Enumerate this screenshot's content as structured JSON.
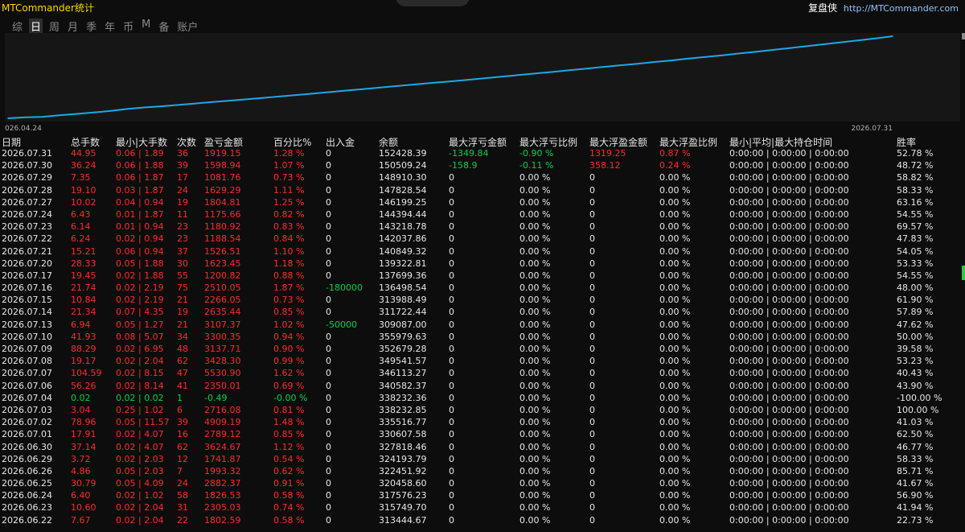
{
  "window": {
    "title": "MTCommander统计",
    "brand_name": "复盘侠",
    "brand_url": "http://MTCommander.com"
  },
  "tabs": [
    {
      "label": "综",
      "active": false
    },
    {
      "label": "日",
      "active": true
    },
    {
      "label": "周",
      "active": false
    },
    {
      "label": "月",
      "active": false
    },
    {
      "label": "季",
      "active": false
    },
    {
      "label": "年",
      "active": false
    },
    {
      "label": "币",
      "active": false
    },
    {
      "label": "M",
      "active": false
    },
    {
      "label": "备",
      "active": false
    },
    {
      "label": "账户",
      "active": false
    }
  ],
  "chart_data": {
    "type": "line",
    "x_start_label": "026.04.24",
    "x_end_label": "2026.07.31",
    "line_color": "#1ea8e6",
    "series": [
      {
        "values": [
          0,
          1.2,
          1.8,
          3.6,
          5.3,
          7.1,
          8.9,
          11.4,
          13.2,
          14.6,
          16.3,
          18.0,
          19.8,
          21.5,
          23.1,
          24.9,
          26.7,
          28.4,
          30.3,
          32.1,
          34.0,
          35.8,
          37.7,
          39.6,
          41.5,
          43.2,
          45.0,
          46.9,
          48.8,
          50.7,
          52.6,
          54.6,
          56.5,
          58.5,
          60.6,
          62.6,
          64.6,
          66.5,
          68.6,
          70.5,
          72.7,
          74.8,
          76.8,
          79.0,
          81.2,
          83.4,
          85.7,
          88.0,
          90.3,
          92.6,
          95.0,
          97.4,
          100
        ]
      }
    ]
  },
  "table": {
    "headers": [
      "日期",
      "总手数",
      "最小|大手数",
      "次数",
      "盈亏金额",
      "百分比%",
      "出入金",
      "余额",
      "最大浮亏金额",
      "最大浮亏比例",
      "最大浮盈金额",
      "最大浮盈比例",
      "最小|平均|最大持仓时间",
      "胜率"
    ],
    "rows": [
      {
        "date": "2026.07.31",
        "lots": "44.95",
        "minmax": "0.06 | 1.89",
        "count": "36",
        "pnl": "1919.15",
        "pct": "1.28 %",
        "flow": "0",
        "bal": "152428.39",
        "mfl": "-1349.84",
        "mflp": "-0.90 %",
        "mfp": "1319.25",
        "mfpp": "0.87 %",
        "time": "0:00:00 | 0:00:00 | 0:00:00",
        "win": "52.78 %",
        "pnl_color": "red",
        "flow_color": "white",
        "mfl_color": "green",
        "mfp_color": "red"
      },
      {
        "date": "2026.07.30",
        "lots": "36.24",
        "minmax": "0.06 | 1.88",
        "count": "39",
        "pnl": "1598.94",
        "pct": "1.07 %",
        "flow": "0",
        "bal": "150509.24",
        "mfl": "-158.9",
        "mflp": "-0.11 %",
        "mfp": "358.12",
        "mfpp": "0.24 %",
        "time": "0:00:00 | 0:00:00 | 0:00:00",
        "win": "48.72 %",
        "pnl_color": "red",
        "flow_color": "white",
        "mfl_color": "green",
        "mfp_color": "red"
      },
      {
        "date": "2026.07.29",
        "lots": "7.35",
        "minmax": "0.06 | 1.87",
        "count": "17",
        "pnl": "1081.76",
        "pct": "0.73 %",
        "flow": "0",
        "bal": "148910.30",
        "mfl": "0",
        "mflp": "0.00 %",
        "mfp": "0",
        "mfpp": "0.00 %",
        "time": "0:00:00 | 0:00:00 | 0:00:00",
        "win": "58.82 %",
        "pnl_color": "red",
        "flow_color": "white",
        "mfl_color": "white",
        "mfp_color": "white"
      },
      {
        "date": "2026.07.28",
        "lots": "19.10",
        "minmax": "0.03 | 1.87",
        "count": "24",
        "pnl": "1629.29",
        "pct": "1.11 %",
        "flow": "0",
        "bal": "147828.54",
        "mfl": "0",
        "mflp": "0.00 %",
        "mfp": "0",
        "mfpp": "0.00 %",
        "time": "0:00:00 | 0:00:00 | 0:00:00",
        "win": "58.33 %",
        "pnl_color": "red",
        "flow_color": "white",
        "mfl_color": "white",
        "mfp_color": "white"
      },
      {
        "date": "2026.07.27",
        "lots": "10.02",
        "minmax": "0.04 | 0.94",
        "count": "19",
        "pnl": "1804.81",
        "pct": "1.25 %",
        "flow": "0",
        "bal": "146199.25",
        "mfl": "0",
        "mflp": "0.00 %",
        "mfp": "0",
        "mfpp": "0.00 %",
        "time": "0:00:00 | 0:00:00 | 0:00:00",
        "win": "63.16 %",
        "pnl_color": "red",
        "flow_color": "white",
        "mfl_color": "white",
        "mfp_color": "white"
      },
      {
        "date": "2026.07.24",
        "lots": "6.43",
        "minmax": "0.01 | 1.87",
        "count": "11",
        "pnl": "1175.66",
        "pct": "0.82 %",
        "flow": "0",
        "bal": "144394.44",
        "mfl": "0",
        "mflp": "0.00 %",
        "mfp": "0",
        "mfpp": "0.00 %",
        "time": "0:00:00 | 0:00:00 | 0:00:00",
        "win": "54.55 %",
        "pnl_color": "red",
        "flow_color": "white",
        "mfl_color": "white",
        "mfp_color": "white"
      },
      {
        "date": "2026.07.23",
        "lots": "6.14",
        "minmax": "0.01 | 0.94",
        "count": "23",
        "pnl": "1180.92",
        "pct": "0.83 %",
        "flow": "0",
        "bal": "143218.78",
        "mfl": "0",
        "mflp": "0.00 %",
        "mfp": "0",
        "mfpp": "0.00 %",
        "time": "0:00:00 | 0:00:00 | 0:00:00",
        "win": "69.57 %",
        "pnl_color": "red",
        "flow_color": "white",
        "mfl_color": "white",
        "mfp_color": "white"
      },
      {
        "date": "2026.07.22",
        "lots": "6.24",
        "minmax": "0.02 | 0.94",
        "count": "23",
        "pnl": "1188.54",
        "pct": "0.84 %",
        "flow": "0",
        "bal": "142037.86",
        "mfl": "0",
        "mflp": "0.00 %",
        "mfp": "0",
        "mfpp": "0.00 %",
        "time": "0:00:00 | 0:00:00 | 0:00:00",
        "win": "47.83 %",
        "pnl_color": "red",
        "flow_color": "white",
        "mfl_color": "white",
        "mfp_color": "white"
      },
      {
        "date": "2026.07.21",
        "lots": "15.21",
        "minmax": "0.06 | 0.94",
        "count": "37",
        "pnl": "1526.51",
        "pct": "1.10 %",
        "flow": "0",
        "bal": "140849.32",
        "mfl": "0",
        "mflp": "0.00 %",
        "mfp": "0",
        "mfpp": "0.00 %",
        "time": "0:00:00 | 0:00:00 | 0:00:00",
        "win": "54.05 %",
        "pnl_color": "red",
        "flow_color": "white",
        "mfl_color": "white",
        "mfp_color": "white"
      },
      {
        "date": "2026.07.20",
        "lots": "28.33",
        "minmax": "0.05 | 1.88",
        "count": "30",
        "pnl": "1623.45",
        "pct": "1.18 %",
        "flow": "0",
        "bal": "139322.81",
        "mfl": "0",
        "mflp": "0.00 %",
        "mfp": "0",
        "mfpp": "0.00 %",
        "time": "0:00:00 | 0:00:00 | 0:00:00",
        "win": "53.33 %",
        "pnl_color": "red",
        "flow_color": "white",
        "mfl_color": "white",
        "mfp_color": "white"
      },
      {
        "date": "2026.07.17",
        "lots": "19.45",
        "minmax": "0.02 | 1.88",
        "count": "55",
        "pnl": "1200.82",
        "pct": "0.88 %",
        "flow": "0",
        "bal": "137699.36",
        "mfl": "0",
        "mflp": "0.00 %",
        "mfp": "0",
        "mfpp": "0.00 %",
        "time": "0:00:00 | 0:00:00 | 0:00:00",
        "win": "54.55 %",
        "pnl_color": "red",
        "flow_color": "white",
        "mfl_color": "white",
        "mfp_color": "white"
      },
      {
        "date": "2026.07.16",
        "lots": "21.74",
        "minmax": "0.02 | 2.19",
        "count": "75",
        "pnl": "2510.05",
        "pct": "1.87 %",
        "flow": "-180000",
        "bal": "136498.54",
        "mfl": "0",
        "mflp": "0.00 %",
        "mfp": "0",
        "mfpp": "0.00 %",
        "time": "0:00:00 | 0:00:00 | 0:00:00",
        "win": "48.00 %",
        "pnl_color": "red",
        "flow_color": "green",
        "mfl_color": "white",
        "mfp_color": "white"
      },
      {
        "date": "2026.07.15",
        "lots": "10.84",
        "minmax": "0.02 | 2.19",
        "count": "21",
        "pnl": "2266.05",
        "pct": "0.73 %",
        "flow": "0",
        "bal": "313988.49",
        "mfl": "0",
        "mflp": "0.00 %",
        "mfp": "0",
        "mfpp": "0.00 %",
        "time": "0:00:00 | 0:00:00 | 0:00:00",
        "win": "61.90 %",
        "pnl_color": "red",
        "flow_color": "white",
        "mfl_color": "white",
        "mfp_color": "white"
      },
      {
        "date": "2026.07.14",
        "lots": "21.34",
        "minmax": "0.07 | 4.35",
        "count": "19",
        "pnl": "2635.44",
        "pct": "0.85 %",
        "flow": "0",
        "bal": "311722.44",
        "mfl": "0",
        "mflp": "0.00 %",
        "mfp": "0",
        "mfpp": "0.00 %",
        "time": "0:00:00 | 0:00:00 | 0:00:00",
        "win": "57.89 %",
        "pnl_color": "red",
        "flow_color": "white",
        "mfl_color": "white",
        "mfp_color": "white"
      },
      {
        "date": "2026.07.13",
        "lots": "6.94",
        "minmax": "0.05 | 1.27",
        "count": "21",
        "pnl": "3107.37",
        "pct": "1.02 %",
        "flow": "-50000",
        "bal": "309087.00",
        "mfl": "0",
        "mflp": "0.00 %",
        "mfp": "0",
        "mfpp": "0.00 %",
        "time": "0:00:00 | 0:00:00 | 0:00:00",
        "win": "47.62 %",
        "pnl_color": "red",
        "flow_color": "green",
        "mfl_color": "white",
        "mfp_color": "white"
      },
      {
        "date": "2026.07.10",
        "lots": "41.93",
        "minmax": "0.08 | 5.07",
        "count": "34",
        "pnl": "3300.35",
        "pct": "0.94 %",
        "flow": "0",
        "bal": "355979.63",
        "mfl": "0",
        "mflp": "0.00 %",
        "mfp": "0",
        "mfpp": "0.00 %",
        "time": "0:00:00 | 0:00:00 | 0:00:00",
        "win": "50.00 %",
        "pnl_color": "red",
        "flow_color": "white",
        "mfl_color": "white",
        "mfp_color": "white"
      },
      {
        "date": "2026.07.09",
        "lots": "88.29",
        "minmax": "0.02 | 6.95",
        "count": "48",
        "pnl": "3137.71",
        "pct": "0.90 %",
        "flow": "0",
        "bal": "352679.28",
        "mfl": "0",
        "mflp": "0.00 %",
        "mfp": "0",
        "mfpp": "0.00 %",
        "time": "0:00:00 | 0:00:00 | 0:00:00",
        "win": "39.58 %",
        "pnl_color": "red",
        "flow_color": "white",
        "mfl_color": "white",
        "mfp_color": "white"
      },
      {
        "date": "2026.07.08",
        "lots": "19.17",
        "minmax": "0.02 | 2.04",
        "count": "62",
        "pnl": "3428.30",
        "pct": "0.99 %",
        "flow": "0",
        "bal": "349541.57",
        "mfl": "0",
        "mflp": "0.00 %",
        "mfp": "0",
        "mfpp": "0.00 %",
        "time": "0:00:00 | 0:00:00 | 0:00:00",
        "win": "53.23 %",
        "pnl_color": "red",
        "flow_color": "white",
        "mfl_color": "white",
        "mfp_color": "white"
      },
      {
        "date": "2026.07.07",
        "lots": "104.59",
        "minmax": "0.02 | 8.15",
        "count": "47",
        "pnl": "5530.90",
        "pct": "1.62 %",
        "flow": "0",
        "bal": "346113.27",
        "mfl": "0",
        "mflp": "0.00 %",
        "mfp": "0",
        "mfpp": "0.00 %",
        "time": "0:00:00 | 0:00:00 | 0:00:00",
        "win": "40.43 %",
        "pnl_color": "red",
        "flow_color": "white",
        "mfl_color": "white",
        "mfp_color": "white"
      },
      {
        "date": "2026.07.06",
        "lots": "56.26",
        "minmax": "0.02 | 8.14",
        "count": "41",
        "pnl": "2350.01",
        "pct": "0.69 %",
        "flow": "0",
        "bal": "340582.37",
        "mfl": "0",
        "mflp": "0.00 %",
        "mfp": "0",
        "mfpp": "0.00 %",
        "time": "0:00:00 | 0:00:00 | 0:00:00",
        "win": "43.90 %",
        "pnl_color": "red",
        "flow_color": "white",
        "mfl_color": "white",
        "mfp_color": "white"
      },
      {
        "date": "2026.07.04",
        "lots": "0.02",
        "minmax": "0.02 | 0.02",
        "count": "1",
        "pnl": "-0.49",
        "pct": "-0.00 %",
        "flow": "0",
        "bal": "338232.36",
        "mfl": "0",
        "mflp": "0.00 %",
        "mfp": "0",
        "mfpp": "0.00 %",
        "time": "0:00:00 | 0:00:00 | 0:00:00",
        "win": "-100.00 %",
        "pnl_color": "green",
        "flow_color": "white",
        "mfl_color": "white",
        "mfp_color": "white"
      },
      {
        "date": "2026.07.03",
        "lots": "3.04",
        "minmax": "0.25 | 1.02",
        "count": "6",
        "pnl": "2716.08",
        "pct": "0.81 %",
        "flow": "0",
        "bal": "338232.85",
        "mfl": "0",
        "mflp": "0.00 %",
        "mfp": "0",
        "mfpp": "0.00 %",
        "time": "0:00:00 | 0:00:00 | 0:00:00",
        "win": "100.00 %",
        "pnl_color": "red",
        "flow_color": "white",
        "mfl_color": "white",
        "mfp_color": "white"
      },
      {
        "date": "2026.07.02",
        "lots": "78.96",
        "minmax": "0.05 | 11.57",
        "count": "39",
        "pnl": "4909.19",
        "pct": "1.48 %",
        "flow": "0",
        "bal": "335516.77",
        "mfl": "0",
        "mflp": "0.00 %",
        "mfp": "0",
        "mfpp": "0.00 %",
        "time": "0:00:00 | 0:00:00 | 0:00:00",
        "win": "41.03 %",
        "pnl_color": "red",
        "flow_color": "white",
        "mfl_color": "white",
        "mfp_color": "white"
      },
      {
        "date": "2026.07.01",
        "lots": "17.91",
        "minmax": "0.02 | 4.07",
        "count": "16",
        "pnl": "2789.12",
        "pct": "0.85 %",
        "flow": "0",
        "bal": "330607.58",
        "mfl": "0",
        "mflp": "0.00 %",
        "mfp": "0",
        "mfpp": "0.00 %",
        "time": "0:00:00 | 0:00:00 | 0:00:00",
        "win": "62.50 %",
        "pnl_color": "red",
        "flow_color": "white",
        "mfl_color": "white",
        "mfp_color": "white"
      },
      {
        "date": "2026.06.30",
        "lots": "37.14",
        "minmax": "0.02 | 4.07",
        "count": "62",
        "pnl": "3624.67",
        "pct": "1.12 %",
        "flow": "0",
        "bal": "327818.46",
        "mfl": "0",
        "mflp": "0.00 %",
        "mfp": "0",
        "mfpp": "0.00 %",
        "time": "0:00:00 | 0:00:00 | 0:00:00",
        "win": "46.77 %",
        "pnl_color": "red",
        "flow_color": "white",
        "mfl_color": "white",
        "mfp_color": "white"
      },
      {
        "date": "2026.06.29",
        "lots": "3.72",
        "minmax": "0.02 | 2.03",
        "count": "12",
        "pnl": "1741.87",
        "pct": "0.54 %",
        "flow": "0",
        "bal": "324193.79",
        "mfl": "0",
        "mflp": "0.00 %",
        "mfp": "0",
        "mfpp": "0.00 %",
        "time": "0:00:00 | 0:00:00 | 0:00:00",
        "win": "58.33 %",
        "pnl_color": "red",
        "flow_color": "white",
        "mfl_color": "white",
        "mfp_color": "white"
      },
      {
        "date": "2026.06.26",
        "lots": "4.86",
        "minmax": "0.05 | 2.03",
        "count": "7",
        "pnl": "1993.32",
        "pct": "0.62 %",
        "flow": "0",
        "bal": "322451.92",
        "mfl": "0",
        "mflp": "0.00 %",
        "mfp": "0",
        "mfpp": "0.00 %",
        "time": "0:00:00 | 0:00:00 | 0:00:00",
        "win": "85.71 %",
        "pnl_color": "red",
        "flow_color": "white",
        "mfl_color": "white",
        "mfp_color": "white"
      },
      {
        "date": "2026.06.25",
        "lots": "30.79",
        "minmax": "0.05 | 4.09",
        "count": "24",
        "pnl": "2882.37",
        "pct": "0.91 %",
        "flow": "0",
        "bal": "320458.60",
        "mfl": "0",
        "mflp": "0.00 %",
        "mfp": "0",
        "mfpp": "0.00 %",
        "time": "0:00:00 | 0:00:00 | 0:00:00",
        "win": "41.67 %",
        "pnl_color": "red",
        "flow_color": "white",
        "mfl_color": "white",
        "mfp_color": "white"
      },
      {
        "date": "2026.06.24",
        "lots": "6.40",
        "minmax": "0.02 | 1.02",
        "count": "58",
        "pnl": "1826.53",
        "pct": "0.58 %",
        "flow": "0",
        "bal": "317576.23",
        "mfl": "0",
        "mflp": "0.00 %",
        "mfp": "0",
        "mfpp": "0.00 %",
        "time": "0:00:00 | 0:00:00 | 0:00:00",
        "win": "56.90 %",
        "pnl_color": "red",
        "flow_color": "white",
        "mfl_color": "white",
        "mfp_color": "white"
      },
      {
        "date": "2026.06.23",
        "lots": "10.60",
        "minmax": "0.02 | 2.04",
        "count": "31",
        "pnl": "2305.03",
        "pct": "0.74 %",
        "flow": "0",
        "bal": "315749.70",
        "mfl": "0",
        "mflp": "0.00 %",
        "mfp": "0",
        "mfpp": "0.00 %",
        "time": "0:00:00 | 0:00:00 | 0:00:00",
        "win": "41.94 %",
        "pnl_color": "red",
        "flow_color": "white",
        "mfl_color": "white",
        "mfp_color": "white"
      },
      {
        "date": "2026.06.22",
        "lots": "7.67",
        "minmax": "0.02 | 2.04",
        "count": "22",
        "pnl": "1802.59",
        "pct": "0.58 %",
        "flow": "0",
        "bal": "313444.67",
        "mfl": "0",
        "mflp": "0.00 %",
        "mfp": "0",
        "mfpp": "0.00 %",
        "time": "0:00:00 | 0:00:00 | 0:00:00",
        "win": "22.73 %",
        "pnl_color": "red",
        "flow_color": "white",
        "mfl_color": "white",
        "mfp_color": "white"
      }
    ]
  }
}
